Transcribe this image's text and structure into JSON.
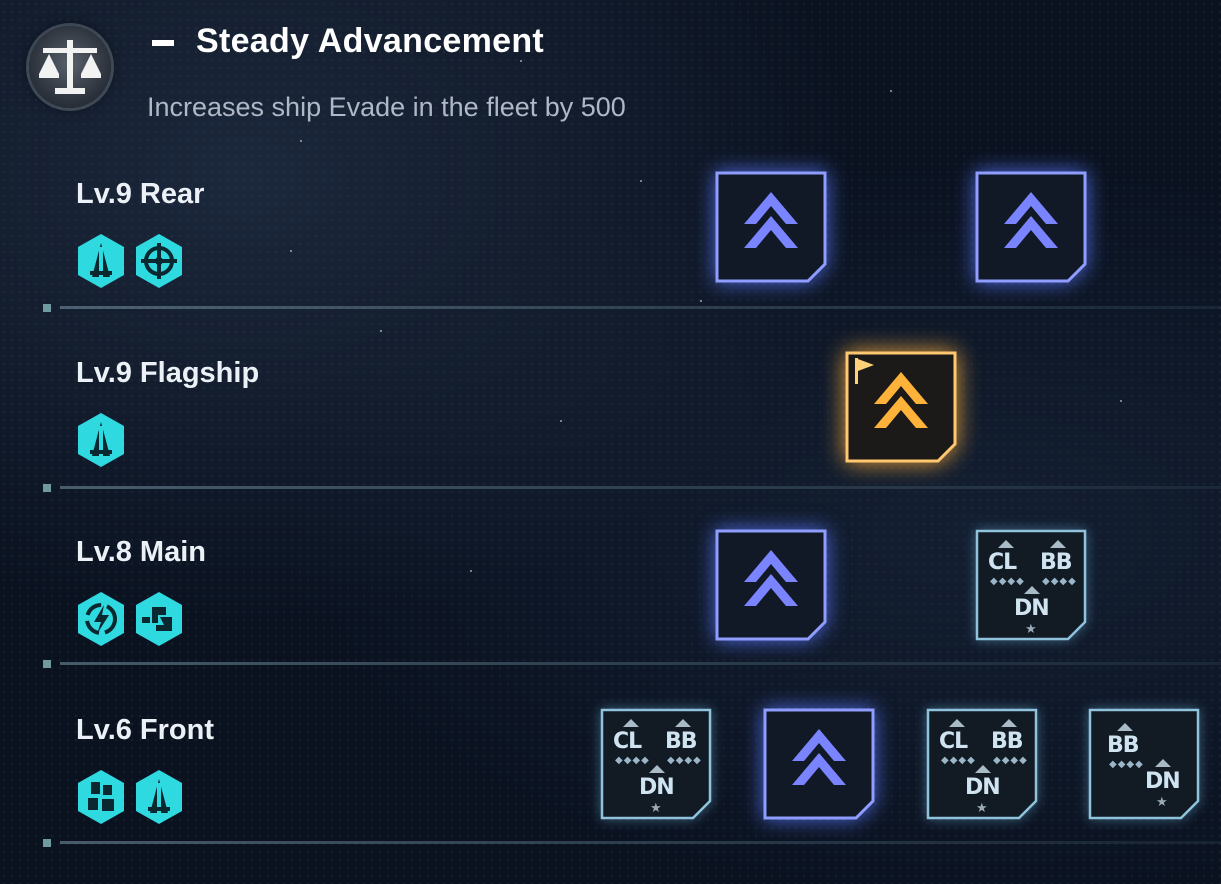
{
  "header": {
    "icon": "balance-scale-icon",
    "title": "Steady Advancement",
    "description": "Increases ship Evade in the fleet by 500"
  },
  "rows": [
    {
      "label": "Lv.9 Rear",
      "roles": [
        "carrier-role-icon",
        "crosshair-role-icon"
      ],
      "slots": [
        {
          "type": "evade-chevron"
        },
        {
          "type": "evade-chevron"
        }
      ]
    },
    {
      "label": "Lv.9 Flagship",
      "roles": [
        "carrier-role-icon"
      ],
      "slots": [
        {
          "type": "flagship-chevron"
        }
      ]
    },
    {
      "label": "Lv.8 Main",
      "roles": [
        "lightning-role-icon",
        "link-role-icon"
      ],
      "slots": [
        {
          "type": "evade-chevron"
        },
        {
          "type": "ship-class",
          "classes": [
            "CL",
            "BB",
            "DN"
          ]
        }
      ]
    },
    {
      "label": "Lv.6 Front",
      "roles": [
        "cluster-role-icon",
        "carrier-role-icon"
      ],
      "slots": [
        {
          "type": "ship-class",
          "classes": [
            "CL",
            "BB",
            "DN"
          ]
        },
        {
          "type": "evade-chevron"
        },
        {
          "type": "ship-class",
          "classes": [
            "CL",
            "BB",
            "DN"
          ]
        },
        {
          "type": "ship-class",
          "classes": [
            "BB",
            "DN"
          ]
        }
      ]
    }
  ],
  "colors": {
    "accent_cyan": "#2fd9e0",
    "evade_blue": "#6f79ff",
    "flagship_gold": "#ffb23a"
  }
}
